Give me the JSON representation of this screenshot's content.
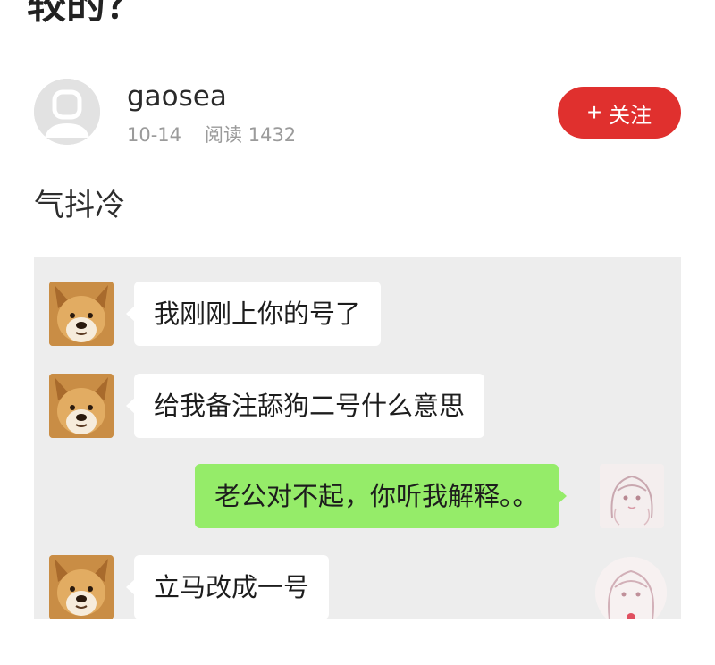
{
  "article": {
    "title_fragment": "较的？",
    "caption": "气抖冷"
  },
  "author": {
    "name": "gaosea",
    "date": "10-14",
    "reads_label": "阅读",
    "reads_count": "1432",
    "avatar_icon": "user-silhouette-icon"
  },
  "follow": {
    "plus_symbol": "+",
    "label": "关注",
    "color": "#e0302e"
  },
  "chat": {
    "background": "#ededed",
    "incoming_bubble_color": "#ffffff",
    "outgoing_bubble_color": "#95ec69",
    "messages": [
      {
        "sender": "other",
        "avatar_icon": "shiba-dog-avatar-icon",
        "text": "我刚刚上你的号了"
      },
      {
        "sender": "other",
        "avatar_icon": "shiba-dog-avatar-icon",
        "text": "给我备注舔狗二号什么意思"
      },
      {
        "sender": "self",
        "avatar_icon": "anime-girl-avatar-icon",
        "text": "老公对不起，你听我解释。。"
      },
      {
        "sender": "other",
        "avatar_icon": "shiba-dog-avatar-icon",
        "text": "立马改成一号"
      }
    ]
  }
}
